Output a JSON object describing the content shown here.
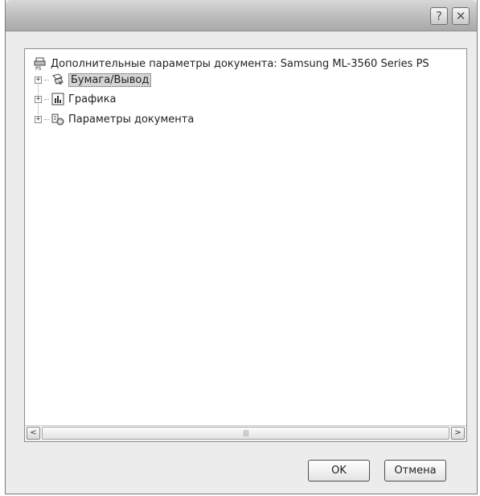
{
  "title_bar": {
    "help_label": "?",
    "close_label": "✕"
  },
  "tree": {
    "root": {
      "label": "Дополнительные параметры документа: Samsung ML-3560 Series PS",
      "icon": "printer-ps-icon"
    },
    "items": [
      {
        "label": "Бумага/Вывод",
        "icon": "paper-output-icon",
        "selected": true,
        "expander": "+"
      },
      {
        "label": "Графика",
        "icon": "graphics-chart-icon",
        "selected": false,
        "expander": "+"
      },
      {
        "label": "Параметры документа",
        "icon": "document-options-icon",
        "selected": false,
        "expander": "+"
      }
    ]
  },
  "scrollbar": {
    "left_arrow": "<",
    "right_arrow": ">",
    "thumb_grip": "||||"
  },
  "buttons": {
    "ok_label": "OK",
    "cancel_label": "Отмена"
  }
}
